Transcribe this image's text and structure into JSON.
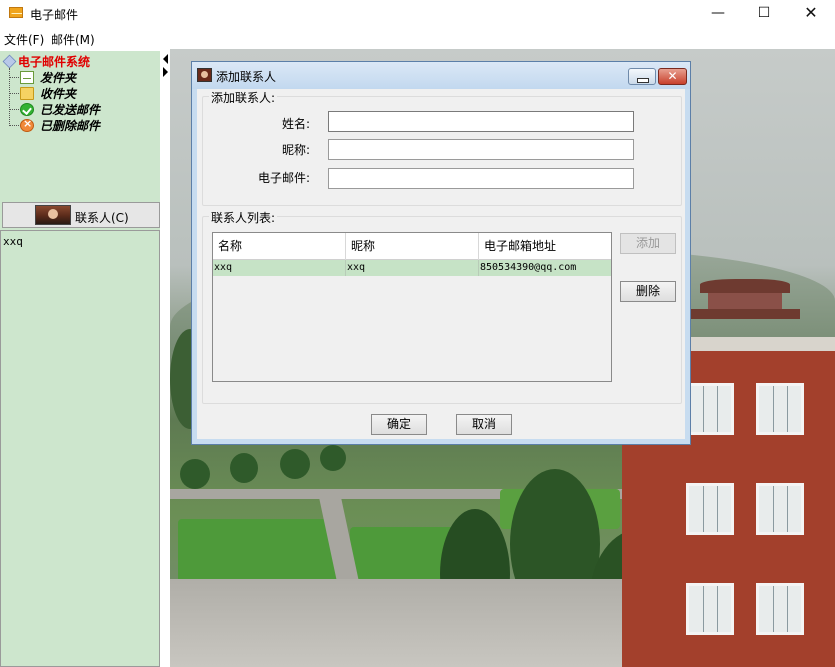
{
  "window": {
    "title": "电子邮件",
    "icon": "mail-icon",
    "controls": {
      "minimize": "—",
      "maximize": "☐",
      "close": "✕"
    }
  },
  "menu": {
    "file": "文件(F)",
    "mail": "邮件(M)"
  },
  "tree": {
    "root": "电子邮件系统",
    "items": [
      {
        "label": "发件夹",
        "icon": "send-mail-icon"
      },
      {
        "label": "收件夹",
        "icon": "folder-icon"
      },
      {
        "label": "已发送邮件",
        "icon": "check-icon"
      },
      {
        "label": "已删除邮件",
        "icon": "delete-icon"
      }
    ]
  },
  "contacts_button": {
    "label": "联系人(C)"
  },
  "contact_list": {
    "items": [
      "xxq"
    ]
  },
  "dialog": {
    "title": "添加联系人",
    "add_group_label": "添加联系人:",
    "fields": {
      "name_label": "姓名:",
      "name_value": "",
      "nickname_label": "昵称:",
      "nickname_value": "",
      "email_label": "电子邮件:",
      "email_value": ""
    },
    "list_group_label": "联系人列表:",
    "table": {
      "headers": [
        "名称",
        "昵称",
        "电子邮箱地址"
      ],
      "rows": [
        [
          "xxq",
          "xxq",
          "850534390@qq.com"
        ]
      ]
    },
    "buttons": {
      "add": "添加",
      "delete": "删除",
      "ok": "确定",
      "cancel": "取消"
    },
    "close_symbol": "✕"
  },
  "colors": {
    "panel_green": "#cde6cd",
    "selected_row": "#c6e3c6",
    "tree_root": "#e00000"
  }
}
